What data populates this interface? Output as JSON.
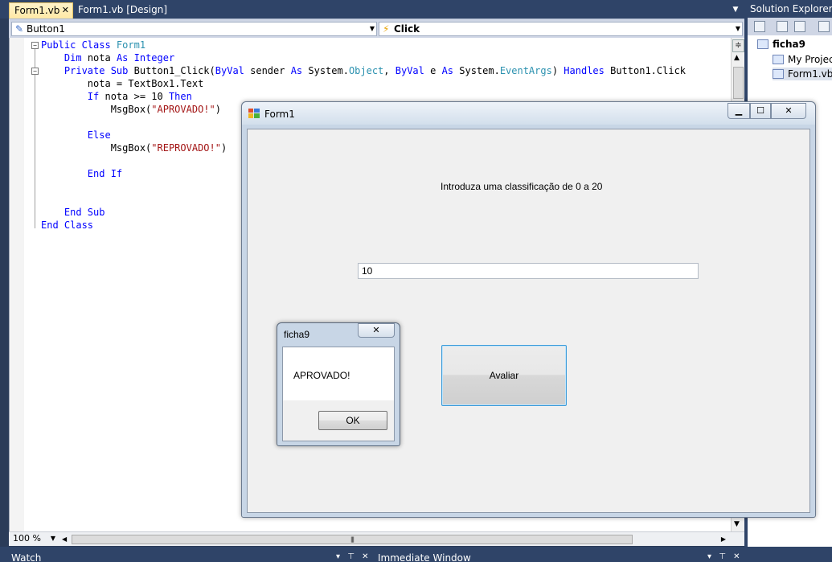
{
  "ide": {
    "doc_tabs": [
      {
        "label": "Form1.vb",
        "active": true
      },
      {
        "label": "Form1.vb [Design]",
        "active": false
      }
    ],
    "nav": {
      "object_combo": "Button1",
      "event_combo": "Click"
    },
    "code_lines": [
      [
        [
          "kw",
          "Public Class "
        ],
        [
          "ty",
          "Form1"
        ]
      ],
      [
        [
          "",
          "    "
        ],
        [
          "kw",
          "Dim"
        ],
        [
          "",
          " nota "
        ],
        [
          "kw",
          "As Integer"
        ]
      ],
      [
        [
          "",
          "    "
        ],
        [
          "kw",
          "Private Sub"
        ],
        [
          "",
          " Button1_Click("
        ],
        [
          "kw",
          "ByVal"
        ],
        [
          "",
          " sender "
        ],
        [
          "kw",
          "As"
        ],
        [
          "",
          " System."
        ],
        [
          "ty",
          "Object"
        ],
        [
          "",
          ", "
        ],
        [
          "kw",
          "ByVal"
        ],
        [
          "",
          " e "
        ],
        [
          "kw",
          "As"
        ],
        [
          "",
          " System."
        ],
        [
          "ty",
          "EventArgs"
        ],
        [
          "",
          ") "
        ],
        [
          "kw",
          "Handles"
        ],
        [
          "",
          " Button1.Click"
        ]
      ],
      [
        [
          "",
          "        nota = TextBox1.Text"
        ]
      ],
      [
        [
          "",
          "        "
        ],
        [
          "kw",
          "If"
        ],
        [
          "",
          " nota >= 10 "
        ],
        [
          "kw",
          "Then"
        ]
      ],
      [
        [
          "",
          "            MsgBox("
        ],
        [
          "st",
          "\"APROVADO!\""
        ],
        [
          "",
          ")"
        ]
      ],
      [
        [
          "",
          ""
        ]
      ],
      [
        [
          "",
          "        "
        ],
        [
          "kw",
          "Else"
        ]
      ],
      [
        [
          "",
          "            MsgBox("
        ],
        [
          "st",
          "\"REPROVADO!\""
        ],
        [
          "",
          ")"
        ]
      ],
      [
        [
          "",
          ""
        ]
      ],
      [
        [
          "",
          "        "
        ],
        [
          "kw",
          "End If"
        ]
      ],
      [
        [
          "",
          ""
        ]
      ],
      [
        [
          "",
          ""
        ]
      ],
      [
        [
          "",
          "    "
        ],
        [
          "kw",
          "End Sub"
        ]
      ],
      [
        [
          "kw",
          "End Class"
        ]
      ]
    ],
    "zoom": "100 %",
    "bottom_panels": {
      "watch": "Watch",
      "immediate": "Immediate Window"
    },
    "solution_explorer": {
      "title": "Solution Explorer",
      "project": "ficha9",
      "items": [
        "My Project",
        "Form1.vb"
      ]
    }
  },
  "form": {
    "title": "Form1",
    "label": "Introduza uma classificação de 0 a 20",
    "textbox_value": "10",
    "button_label": "Avaliar"
  },
  "msgbox": {
    "title": "ficha9",
    "message": "APROVADO!",
    "ok_label": "OK"
  }
}
